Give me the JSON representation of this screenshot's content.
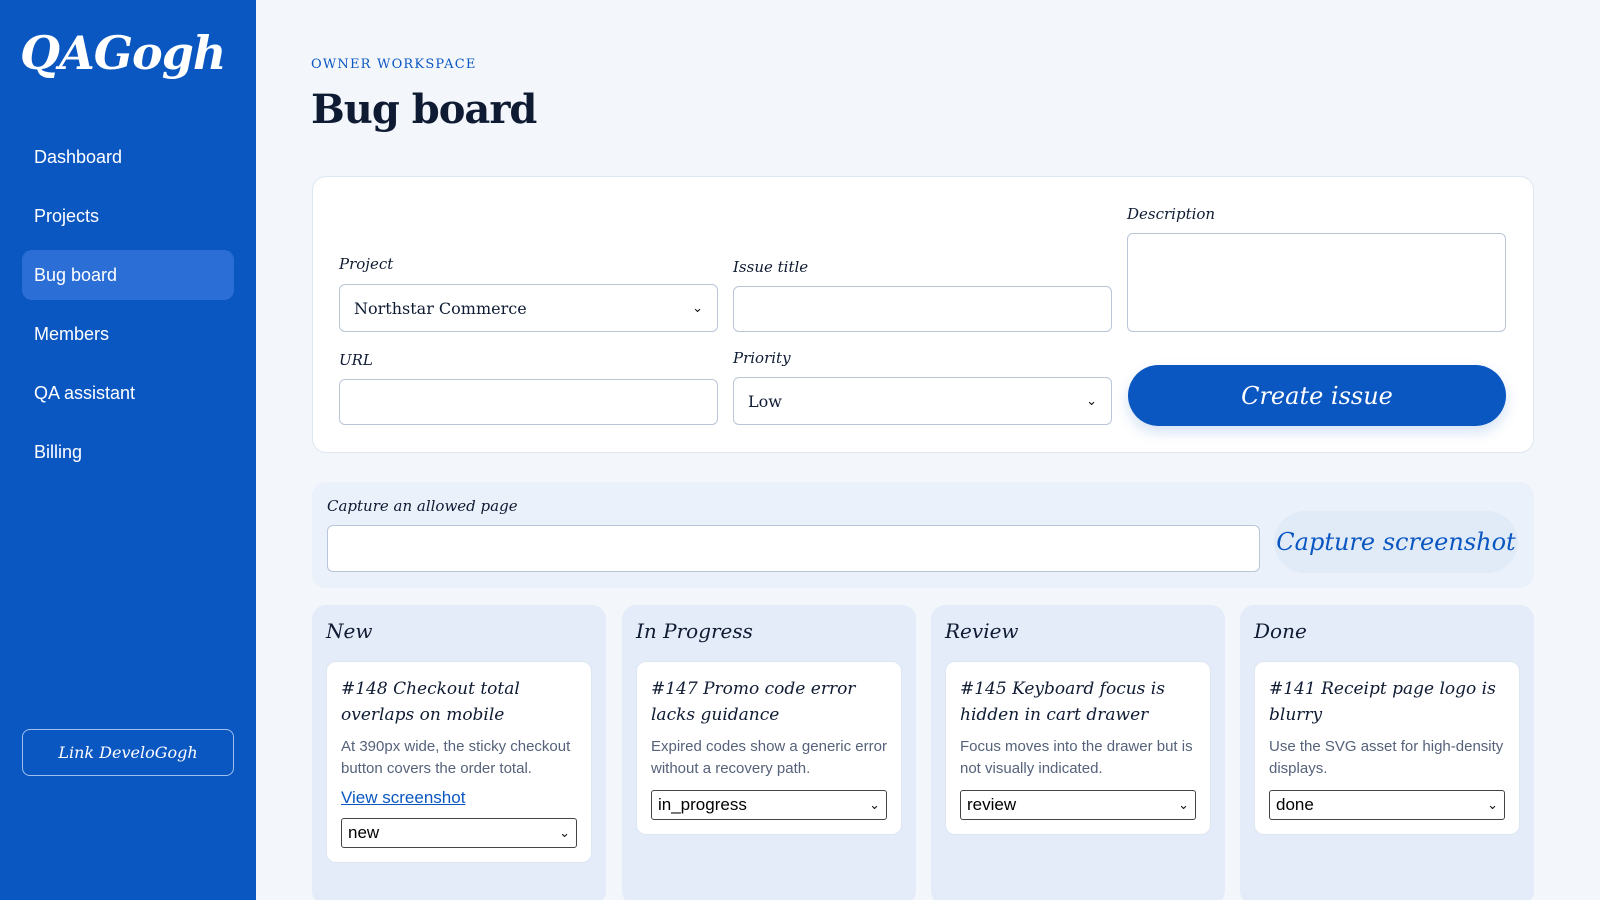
{
  "brand": {
    "logo_text": "QAGogh"
  },
  "sidebar": {
    "items": [
      {
        "label": "Dashboard",
        "active": false
      },
      {
        "label": "Projects",
        "active": false
      },
      {
        "label": "Bug board",
        "active": true
      },
      {
        "label": "Members",
        "active": false
      },
      {
        "label": "QA assistant",
        "active": false
      },
      {
        "label": "Billing",
        "active": false
      }
    ],
    "link_button": "Link DeveloGogh"
  },
  "header": {
    "eyebrow": "OWNER WORKSPACE",
    "title": "Bug board"
  },
  "form": {
    "project_label": "Project",
    "project_value": "Northstar Commerce",
    "issue_title_label": "Issue title",
    "issue_title_value": "",
    "description_label": "Description",
    "description_value": "",
    "url_label": "URL",
    "url_value": "",
    "priority_label": "Priority",
    "priority_value": "Low",
    "create_button": "Create issue"
  },
  "capture": {
    "label": "Capture an allowed page",
    "value": "",
    "button": "Capture screenshot"
  },
  "columns": [
    {
      "title": "New",
      "cards": [
        {
          "title": "#148 Checkout total overlaps on mobile",
          "description": "At 390px wide, the sticky checkout button covers the order total.",
          "link": "View screenshot",
          "status": "new"
        }
      ]
    },
    {
      "title": "In Progress",
      "cards": [
        {
          "title": "#147 Promo code error lacks guidance",
          "description": "Expired codes show a generic error without a recovery path.",
          "status": "in_progress"
        }
      ]
    },
    {
      "title": "Review",
      "cards": [
        {
          "title": "#145 Keyboard focus is hidden in cart drawer",
          "description": "Focus moves into the drawer but is not visually indicated.",
          "status": "review"
        }
      ]
    },
    {
      "title": "Done",
      "cards": [
        {
          "title": "#141 Receipt page logo is blurry",
          "description": "Use the SVG asset for high-density displays.",
          "status": "done"
        }
      ]
    }
  ],
  "colors": {
    "accent": "#0a57c2",
    "background": "#f3f7fb",
    "column_bg": "#e3ecf8"
  },
  "icons": {
    "select_arrow": "chevron-down-icon"
  }
}
